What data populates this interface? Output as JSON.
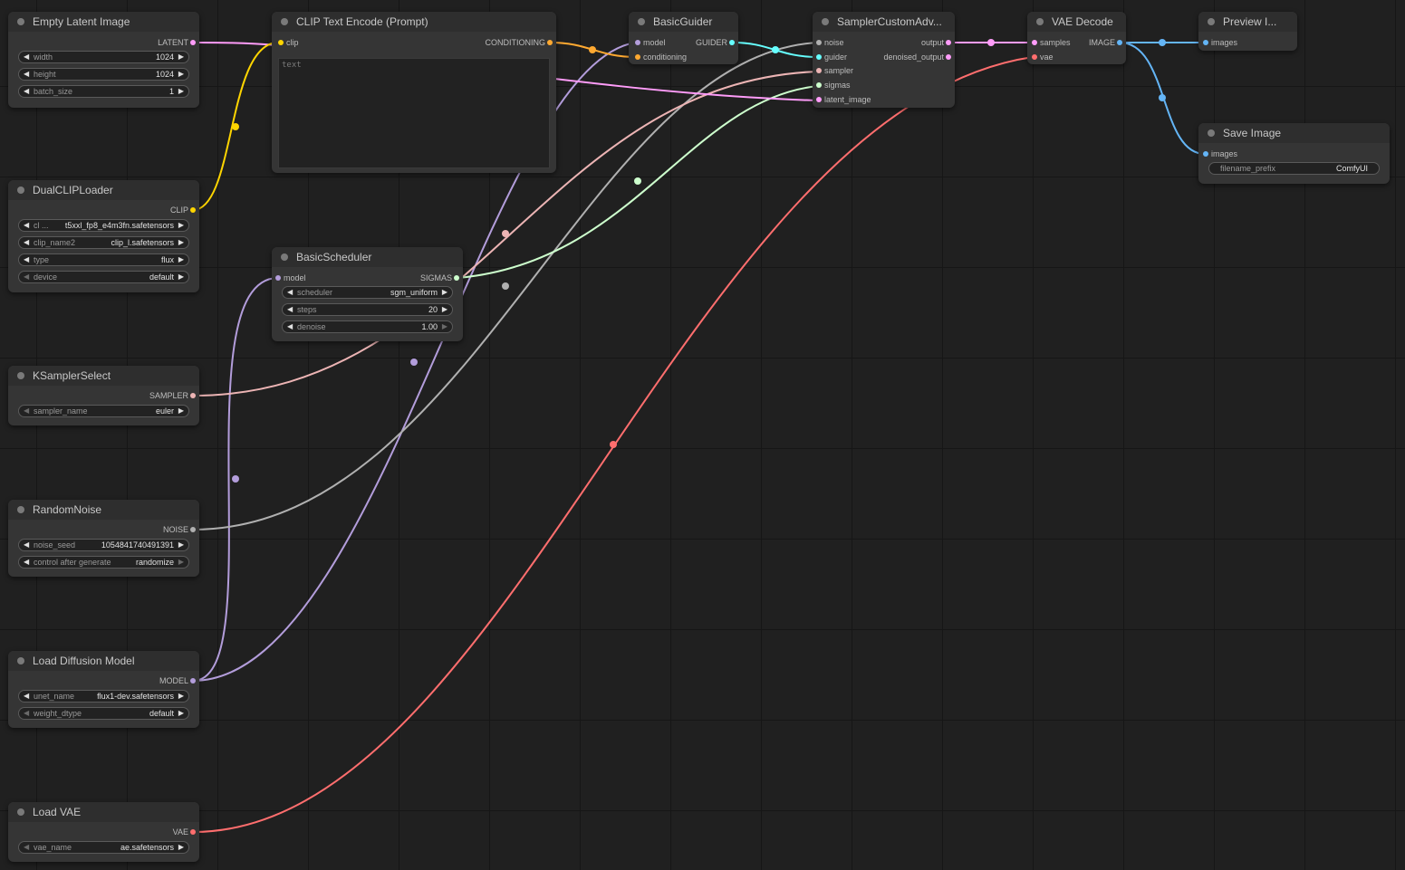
{
  "colors": {
    "latent": "#ff9cf9",
    "clip": "#ffd500",
    "conditioning": "#ffa931",
    "model": "#b39ddb",
    "guider": "#66ffff",
    "noise": "#b0b0b0",
    "sampler": "#ecb4b4",
    "sigmas": "#cdffcd",
    "vae": "#ff6e6e",
    "image": "#64b5f6"
  },
  "nodes": {
    "empty_latent": {
      "title": "Empty Latent Image",
      "out_latent": "LATENT",
      "width_label": "width",
      "width_value": "1024",
      "height_label": "height",
      "height_value": "1024",
      "batch_label": "batch_size",
      "batch_value": "1"
    },
    "dual_clip": {
      "title": "DualCLIPLoader",
      "out_clip": "CLIP",
      "clip1_label": "cl ...",
      "clip1_value": "t5xxl_fp8_e4m3fn.safetensors",
      "clip2_label": "clip_name2",
      "clip2_value": "clip_l.safetensors",
      "type_label": "type",
      "type_value": "flux",
      "device_label": "device",
      "device_value": "default"
    },
    "clip_text": {
      "title": "CLIP Text Encode (Prompt)",
      "in_clip": "clip",
      "out_conditioning": "CONDITIONING",
      "text_placeholder": "text"
    },
    "basic_scheduler": {
      "title": "BasicScheduler",
      "in_model": "model",
      "out_sigmas": "SIGMAS",
      "scheduler_label": "scheduler",
      "scheduler_value": "sgm_uniform",
      "steps_label": "steps",
      "steps_value": "20",
      "denoise_label": "denoise",
      "denoise_value": "1.00"
    },
    "ksampler_select": {
      "title": "KSamplerSelect",
      "out_sampler": "SAMPLER",
      "sampler_label": "sampler_name",
      "sampler_value": "euler"
    },
    "random_noise": {
      "title": "RandomNoise",
      "out_noise": "NOISE",
      "seed_label": "noise_seed",
      "seed_value": "1054841740491391",
      "control_label": "control after generate",
      "control_value": "randomize"
    },
    "load_diffusion": {
      "title": "Load Diffusion Model",
      "out_model": "MODEL",
      "unet_label": "unet_name",
      "unet_value": "flux1-dev.safetensors",
      "dtype_label": "weight_dtype",
      "dtype_value": "default"
    },
    "load_vae": {
      "title": "Load VAE",
      "out_vae": "VAE",
      "vae_label": "vae_name",
      "vae_value": "ae.safetensors"
    },
    "basic_guider": {
      "title": "BasicGuider",
      "in_model": "model",
      "in_conditioning": "conditioning",
      "out_guider": "GUIDER"
    },
    "sampler_custom": {
      "title": "SamplerCustomAdv...",
      "in_noise": "noise",
      "in_guider": "guider",
      "in_sampler": "sampler",
      "in_sigmas": "sigmas",
      "in_latent": "latent_image",
      "out_output": "output",
      "out_denoised": "denoised_output"
    },
    "vae_decode": {
      "title": "VAE Decode",
      "in_samples": "samples",
      "in_vae": "vae",
      "out_image": "IMAGE"
    },
    "preview_image": {
      "title": "Preview I...",
      "in_images": "images"
    },
    "save_image": {
      "title": "Save Image",
      "in_images": "images",
      "prefix_label": "filename_prefix",
      "prefix_value": "ComfyUI"
    }
  }
}
